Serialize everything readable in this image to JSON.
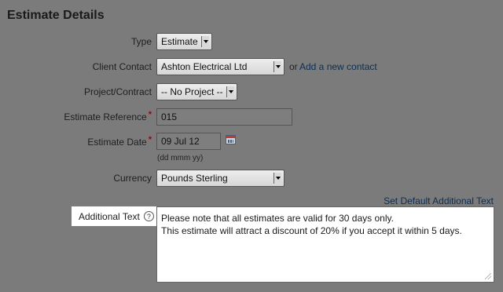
{
  "page_title": "Estimate Details",
  "fields": {
    "type": {
      "label": "Type",
      "value": "Estimate"
    },
    "client_contact": {
      "label": "Client Contact",
      "value": "Ashton Electrical Ltd",
      "or_text": "or",
      "add_link": "Add a new contact"
    },
    "project": {
      "label": "Project/Contract",
      "value": "-- No Project --"
    },
    "reference": {
      "label": "Estimate Reference",
      "required_mark": "*",
      "value": "015"
    },
    "date": {
      "label": "Estimate Date",
      "required_mark": "*",
      "value": "09 Jul 12",
      "hint": "(dd mmm yy)",
      "icon": "calendar-icon"
    },
    "currency": {
      "label": "Currency",
      "value": "Pounds Sterling"
    }
  },
  "additional_text": {
    "label": "Additional Text",
    "help_glyph": "?",
    "set_default_link": "Set Default Additional Text",
    "lines": [
      "Please note that all estimates are valid for 30 days only.",
      "This estimate will attract a discount of 20% if you accept it within 5 days."
    ]
  },
  "colors": {
    "overlay_background": "#7b7b7b",
    "required": "#a30000",
    "link": "#0d2d52"
  }
}
